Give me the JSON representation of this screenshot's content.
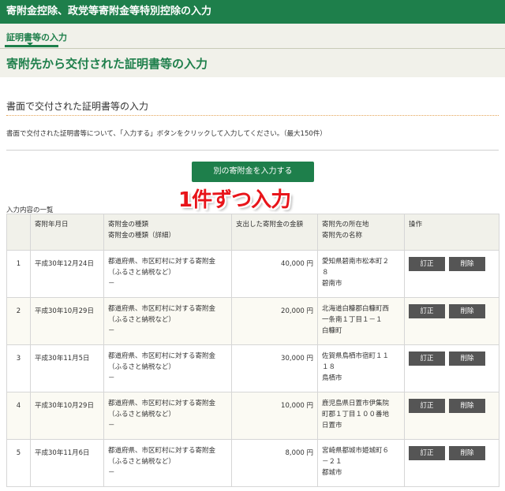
{
  "header": {
    "title": "寄附金控除、政党等寄附金等特別控除の入力"
  },
  "tab": {
    "label": "証明書等の入力"
  },
  "section": {
    "title": "寄附先から交付された証明書等の入力"
  },
  "content": {
    "subheading": "書面で交付された証明書等の入力",
    "description": "書面で交付された証明書等について、「入力する」ボタンをクリックして入力してください。（最大150件）",
    "add_button": "別の寄附金を入力する",
    "overlay_text": "1件ずつ入力",
    "list_caption": "入力内容の一覧"
  },
  "table": {
    "headers": {
      "num": "",
      "date": "寄附年月日",
      "type_1": "寄附金の種類",
      "type_2": "寄附金の種類（詳細）",
      "amount": "支出した寄附金の金額",
      "addr_1": "寄附先の所在地",
      "addr_2": "寄附先の名称",
      "ops": "操作"
    },
    "edit_label": "訂正",
    "delete_label": "削除",
    "rows": [
      {
        "num": "1",
        "date": "平成30年12月24日",
        "type_1": "都道府県、市区町村に対する寄附金",
        "type_2": "（ふるさと納税など）",
        "type_3": "－",
        "amount": "40,000 円",
        "addr_1": "愛知県碧南市松本町２",
        "addr_2": "８",
        "addr_3": "碧南市"
      },
      {
        "num": "2",
        "date": "平成30年10月29日",
        "type_1": "都道府県、市区町村に対する寄附金",
        "type_2": "（ふるさと納税など）",
        "type_3": "－",
        "amount": "20,000 円",
        "addr_1": "北海道白糠郡白糠町西",
        "addr_2": "一条南１丁目１－１",
        "addr_3": "白糠町"
      },
      {
        "num": "3",
        "date": "平成30年11月5日",
        "type_1": "都道府県、市区町村に対する寄附金",
        "type_2": "（ふるさと納税など）",
        "type_3": "－",
        "amount": "30,000 円",
        "addr_1": "佐賀県鳥栖市宿町１１",
        "addr_2": "１８",
        "addr_3": "鳥栖市"
      },
      {
        "num": "4",
        "date": "平成30年10月29日",
        "type_1": "都道府県、市区町村に対する寄附金",
        "type_2": "（ふるさと納税など）",
        "type_3": "－",
        "amount": "10,000 円",
        "addr_1": "鹿児島県日置市伊集院",
        "addr_2": "町郡１丁目１００番地",
        "addr_3": "日置市"
      },
      {
        "num": "5",
        "date": "平成30年11月6日",
        "type_1": "都道府県、市区町村に対する寄附金",
        "type_2": "（ふるさと納税など）",
        "type_3": "－",
        "amount": "8,000 円",
        "addr_1": "宮崎県都城市姫城町６",
        "addr_2": "－２１",
        "addr_3": "都城市"
      }
    ]
  }
}
